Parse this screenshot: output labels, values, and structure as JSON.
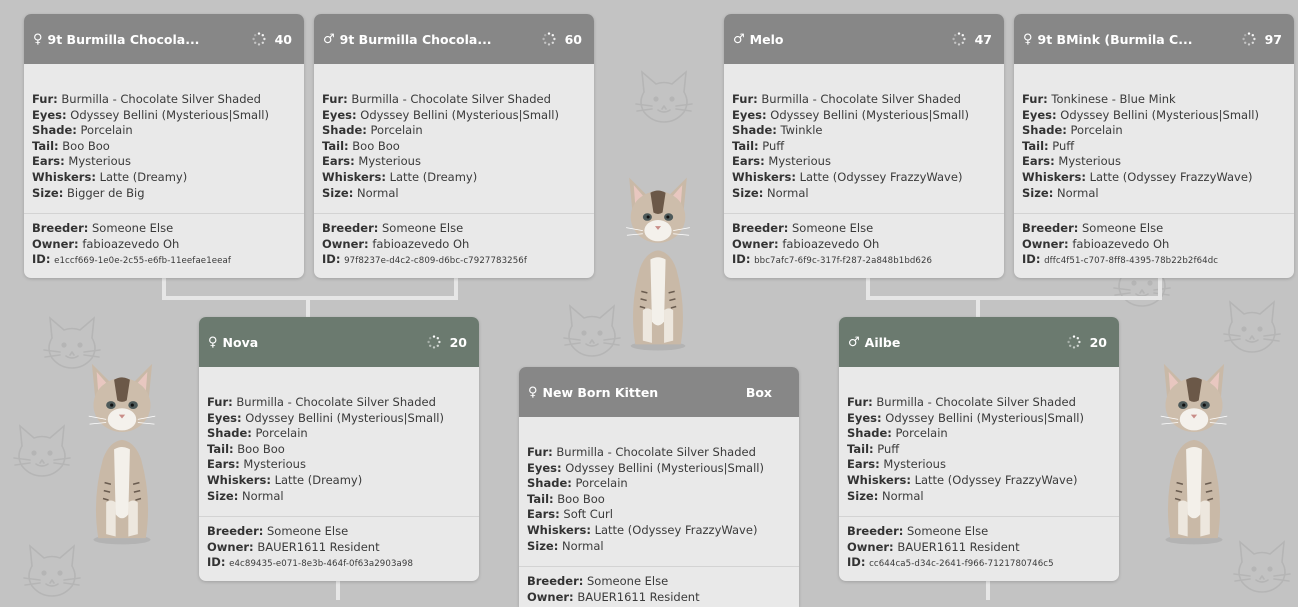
{
  "labels": {
    "fur": "Fur:",
    "eyes": "Eyes:",
    "shade": "Shade:",
    "tail": "Tail:",
    "ears": "Ears:",
    "whiskers": "Whiskers:",
    "size": "Size:",
    "breeder": "Breeder:",
    "owner": "Owner:",
    "id": "ID:"
  },
  "cards": {
    "gp1": {
      "sex": "♀",
      "name": "9t Burmilla Chocola...",
      "loading": "40",
      "fur": "Burmilla - Chocolate Silver Shaded",
      "eyes": "Odyssey Bellini (Mysterious|Small)",
      "shade": "Porcelain",
      "tail": "Boo Boo",
      "ears": "Mysterious",
      "whiskers": "Latte (Dreamy)",
      "size": "Bigger de Big",
      "breeder": "Someone Else",
      "owner": "fabioazevedo Oh",
      "id": "e1ccf669-1e0e-2c55-e6fb-11eefae1eeaf"
    },
    "gp2": {
      "sex": "♂",
      "name": "9t Burmilla Chocola...",
      "loading": "60",
      "fur": "Burmilla - Chocolate Silver Shaded",
      "eyes": "Odyssey Bellini (Mysterious|Small)",
      "shade": "Porcelain",
      "tail": "Boo Boo",
      "ears": "Mysterious",
      "whiskers": "Latte (Dreamy)",
      "size": "Normal",
      "breeder": "Someone Else",
      "owner": "fabioazevedo Oh",
      "id": "97f8237e-d4c2-c809-d6bc-c7927783256f"
    },
    "gp3": {
      "sex": "♂",
      "name": "Melo",
      "loading": "47",
      "fur": "Burmilla - Chocolate Silver Shaded",
      "eyes": "Odyssey Bellini (Mysterious|Small)",
      "shade": "Twinkle",
      "tail": "Puff",
      "ears": "Mysterious",
      "whiskers": "Latte (Odyssey FrazzyWave)",
      "size": "Normal",
      "breeder": "Someone Else",
      "owner": "fabioazevedo Oh",
      "id": "bbc7afc7-6f9c-317f-f287-2a848b1bd626"
    },
    "gp4": {
      "sex": "♀",
      "name": "9t BMink (Burmila C...",
      "loading": "97",
      "fur": "Tonkinese - Blue Mink",
      "eyes": "Odyssey Bellini (Mysterious|Small)",
      "shade": "Porcelain",
      "tail": "Puff",
      "ears": "Mysterious",
      "whiskers": "Latte (Odyssey FrazzyWave)",
      "size": "Normal",
      "breeder": "Someone Else",
      "owner": "fabioazevedo Oh",
      "id": "dffc4f51-c707-8ff8-4395-78b22b2f64dc"
    },
    "mother": {
      "sex": "♀",
      "name": "Nova",
      "loading": "20",
      "fur": "Burmilla - Chocolate Silver Shaded",
      "eyes": "Odyssey Bellini (Mysterious|Small)",
      "shade": "Porcelain",
      "tail": "Boo Boo",
      "ears": "Mysterious",
      "whiskers": "Latte (Dreamy)",
      "size": "Normal",
      "breeder": "Someone Else",
      "owner": "BAUER1611 Resident",
      "id": "e4c89435-e071-8e3b-464f-0f63a2903a98"
    },
    "kitten": {
      "sex": "♀",
      "name": "New Born Kitten",
      "box_label": "Box",
      "fur": "Burmilla - Chocolate Silver Shaded",
      "eyes": "Odyssey Bellini (Mysterious|Small)",
      "shade": "Porcelain",
      "tail": "Boo Boo",
      "ears": "Soft Curl",
      "whiskers": "Latte (Odyssey FrazzyWave)",
      "size": "Normal",
      "breeder": "Someone Else",
      "owner": "BAUER1611 Resident"
    },
    "father": {
      "sex": "♂",
      "name": "Ailbe",
      "loading": "20",
      "fur": "Burmilla - Chocolate Silver Shaded",
      "eyes": "Odyssey Bellini (Mysterious|Small)",
      "shade": "Porcelain",
      "tail": "Puff",
      "ears": "Mysterious",
      "whiskers": "Latte (Odyssey FrazzyWave)",
      "size": "Normal",
      "breeder": "Someone Else",
      "owner": "BAUER1611 Resident",
      "id": "cc644ca5-d34c-2641-f966-7121780746c5"
    }
  },
  "colors": {
    "background": "#c3c3c3",
    "card_header_gray": "#878787",
    "card_header_green": "#6b7a6f",
    "card_body": "#e9e9e9",
    "connector": "#e6e6e6"
  },
  "icons": {
    "loading": "loading-spinner-icon",
    "sex_female": "female-symbol",
    "sex_male": "male-symbol",
    "cat_figure": "cat-figure",
    "background_cat": "cat-face-outline-icon"
  }
}
